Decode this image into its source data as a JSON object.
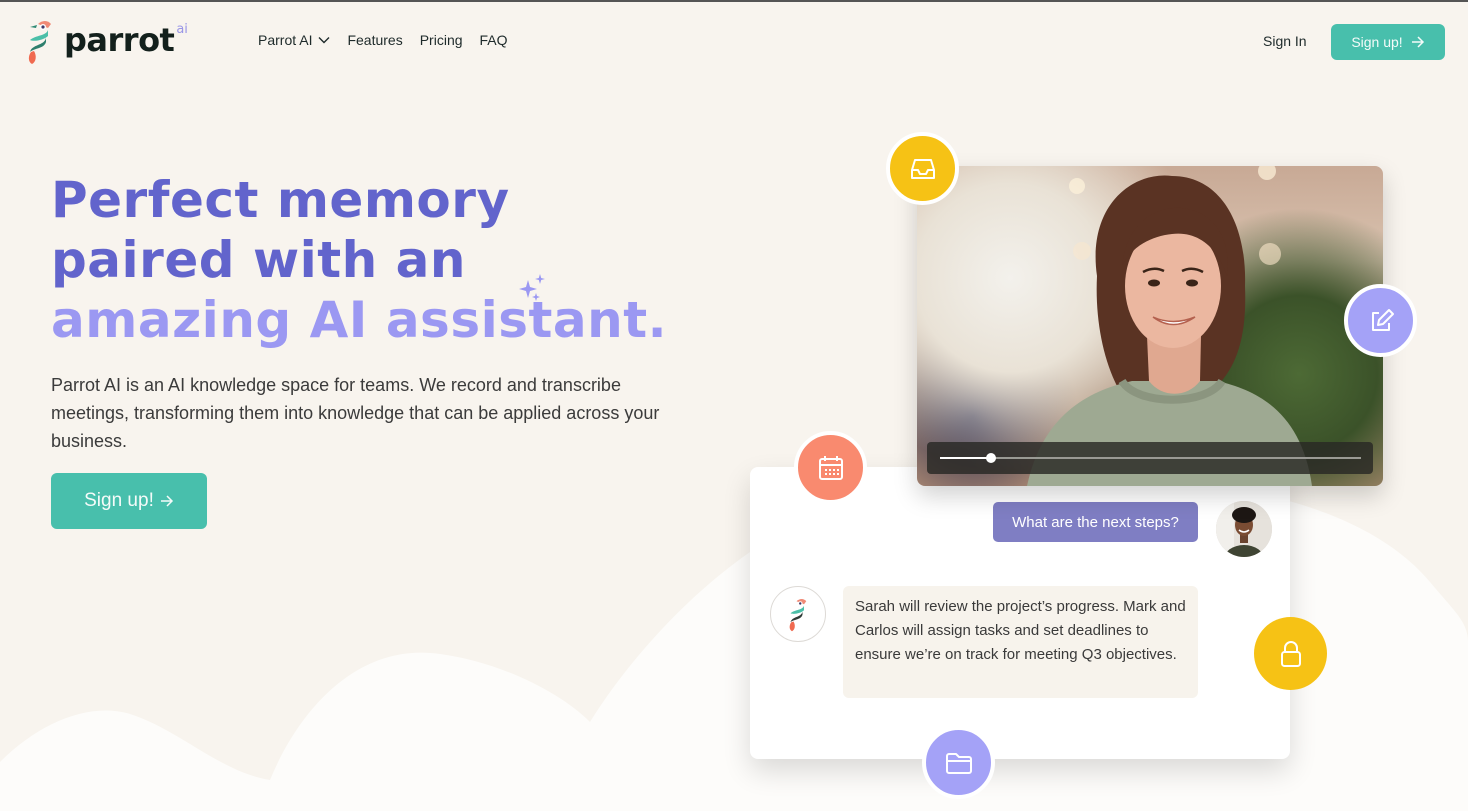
{
  "brand": {
    "name": "parrot",
    "suffix": "ai"
  },
  "nav": {
    "items": [
      {
        "label": "Parrot AI",
        "has_dropdown": true
      },
      {
        "label": "Features"
      },
      {
        "label": "Pricing"
      },
      {
        "label": "FAQ"
      }
    ],
    "signin_label": "Sign In",
    "signup_label": "Sign up!"
  },
  "hero": {
    "title_line1": "Perfect memory",
    "title_line2": "paired with an",
    "title_line3": "amazing AI assistant.",
    "description": "Parrot AI is an AI knowledge space for teams. We record and transcribe meetings, transforming them into knowledge that can be applied across your business.",
    "cta_label": "Sign up!"
  },
  "video": {
    "progress": 0.12
  },
  "chat": {
    "user_message": "What are the next steps?",
    "bot_message": "Sarah will review the project’s progress. Mark and Carlos will assign tasks and set deadlines to ensure we’re on track for meeting Q3 objectives."
  },
  "floating_icons": [
    "inbox-icon",
    "edit-icon",
    "calendar-icon",
    "lock-icon",
    "folder-icon"
  ],
  "colors": {
    "background": "#f8f4ee",
    "accent_teal": "#48bfac",
    "title_purple": "#6264cc",
    "title_light_purple": "#9b98f2",
    "yellow": "#f6c215",
    "lavender": "#a4a2f7",
    "coral": "#f98a6f",
    "user_bubble": "#7f7ec3"
  }
}
